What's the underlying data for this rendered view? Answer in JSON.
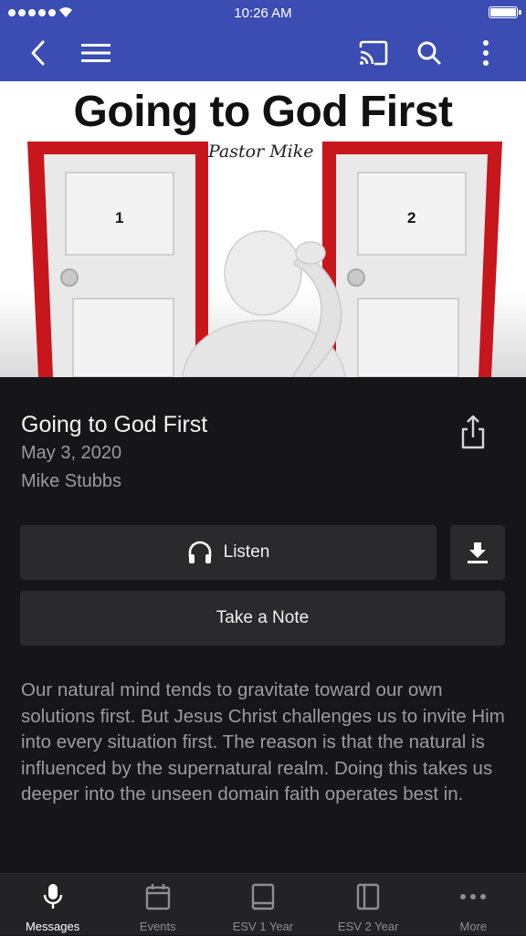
{
  "status": {
    "time": "10:26 AM"
  },
  "navbar": {
    "back_icon": "chevron-left-icon",
    "menu_icon": "hamburger-menu-icon",
    "cast_icon": "cast-icon",
    "search_icon": "search-icon",
    "more_icon": "vertical-dots-icon",
    "color": "#3b4db3"
  },
  "hero": {
    "title": "Going to God First",
    "subtitle": "Pastor Mike",
    "door_left_number": "1",
    "door_right_number": "2"
  },
  "message": {
    "title": "Going to God First",
    "date": "May 3, 2020",
    "speaker": "Mike Stubbs",
    "share_icon": "share-icon"
  },
  "actions": {
    "listen_label": "Listen",
    "listen_icon": "headphones-icon",
    "download_icon": "download-icon",
    "note_label": "Take a Note"
  },
  "description": "Our natural mind tends to gravitate toward our own solutions first. But Jesus Christ challenges us to invite Him into every situation first. The reason is that the natural is influenced by the supernatural realm. Doing this takes us deeper into the unseen domain faith operates best in.",
  "tabs": [
    {
      "label": "Messages",
      "icon": "microphone-icon",
      "active": true
    },
    {
      "label": "Events",
      "icon": "calendar-icon",
      "active": false
    },
    {
      "label": "ESV 1 Year",
      "icon": "book-icon",
      "active": false
    },
    {
      "label": "ESV 2 Year",
      "icon": "book-open-icon",
      "active": false
    },
    {
      "label": "More",
      "icon": "more-dots-icon",
      "active": false
    }
  ]
}
